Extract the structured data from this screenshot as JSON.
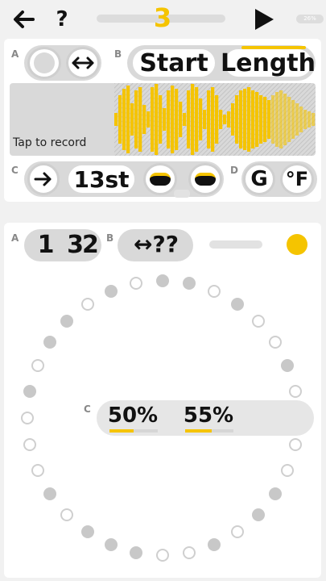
{
  "header": {
    "back_icon": "arrow-left-icon",
    "help_label": "?",
    "pattern_number": "3",
    "play_icon": "play-icon",
    "battery_label": "26%"
  },
  "sample_panel": {
    "section_a": "A",
    "section_b": "B",
    "section_c": "C",
    "section_d": "D",
    "start_label": "Start",
    "length_label": "Length",
    "tap_to_record": "Tap to record",
    "pitch_value": "13st",
    "key_label": "G",
    "temp_label": "°F"
  },
  "sequencer_panel": {
    "section_a": "A",
    "section_b": "B",
    "section_c": "C",
    "steps_left": "1",
    "steps_right": "32",
    "swap_label": "↔??",
    "percent_left": "50%",
    "percent_right": "55%",
    "ring_steps": 32,
    "ring_filled": [
      0,
      1,
      3,
      6,
      8,
      11,
      12,
      14,
      17,
      18,
      19,
      21,
      25,
      27,
      28,
      30
    ]
  },
  "colors": {
    "accent": "#f5c400",
    "pill": "#d9d9d9",
    "background": "#f1f1f1"
  }
}
